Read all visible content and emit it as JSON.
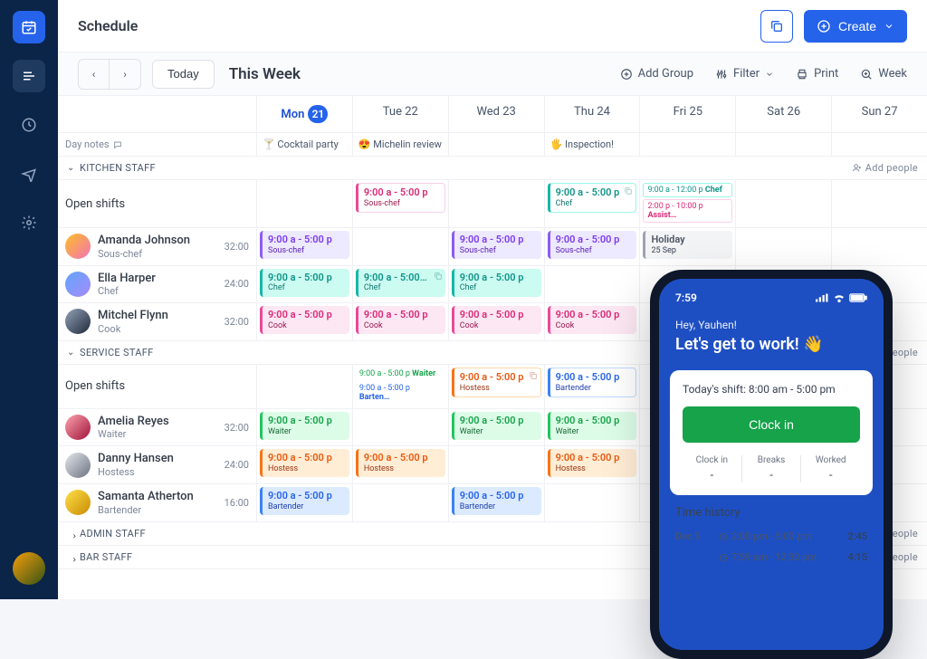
{
  "page": {
    "title": "Schedule"
  },
  "topbar": {
    "create_label": "Create"
  },
  "toolbar": {
    "today": "Today",
    "this_week": "This Week",
    "add_group": "Add Group",
    "filter": "Filter",
    "print": "Print",
    "week": "Week"
  },
  "days": [
    {
      "label": "Mon",
      "num": "21",
      "today": true
    },
    {
      "label": "Tue 22"
    },
    {
      "label": "Wed 23"
    },
    {
      "label": "Thu 24"
    },
    {
      "label": "Fri 25"
    },
    {
      "label": "Sat 26"
    },
    {
      "label": "Sun 27"
    }
  ],
  "notes": {
    "label": "Day notes",
    "cells": [
      "🍸 Cocktail party",
      "😍 Michelin review",
      "",
      "🖐 Inspection!",
      "",
      "",
      ""
    ]
  },
  "groups": {
    "kitchen": {
      "label": "KITCHEN STAFF"
    },
    "service": {
      "label": "SERVICE STAFF"
    },
    "admin": {
      "label": "ADMIN STAFF"
    },
    "bar": {
      "label": "BAR STAFF"
    },
    "add_people": "Add people",
    "open_shifts": "Open shifts"
  },
  "kitchen_open": {
    "tue": {
      "time": "9:00 a - 5:00 p",
      "role": "Sous-chef"
    },
    "thu": {
      "time": "9:00 a - 5:00 p",
      "role": "Chef"
    },
    "fri_a": {
      "time": "9:00 a - 12:00 p",
      "role": "Chef"
    },
    "fri_b": {
      "time": "2:00 p - 10:00 p",
      "role": "Assist…"
    }
  },
  "people": {
    "amanda": {
      "name": "Amanda Johnson",
      "role": "Sous-chef",
      "hours": "32:00"
    },
    "ella": {
      "name": "Ella Harper",
      "role": "Chef",
      "hours": "24:00"
    },
    "mitchel": {
      "name": "Mitchel Flynn",
      "role": "Cook",
      "hours": "32:00"
    },
    "amelia": {
      "name": "Amelia Reyes",
      "role": "Waiter",
      "hours": "32:00"
    },
    "danny": {
      "name": "Danny Hansen",
      "role": "Hostess",
      "hours": "24:00"
    },
    "samanta": {
      "name": "Samanta Atherton",
      "role": "Bartender",
      "hours": "16:00"
    }
  },
  "shifts": {
    "amanda": {
      "mon": {
        "time": "9:00 a - 5:00 p",
        "role": "Sous-chef"
      },
      "wed": {
        "time": "9:00 a - 5:00 p",
        "role": "Sous-chef"
      },
      "thu": {
        "time": "9:00 a - 5:00 p",
        "role": "Sous-chef"
      },
      "fri": {
        "time": "Holiday",
        "role": "25 Sep"
      }
    },
    "ella": {
      "mon": {
        "time": "9:00 a - 5:00 p",
        "role": "Chef"
      },
      "tue": {
        "time": "9:00 a - 5:00…",
        "role": "Chef"
      },
      "wed": {
        "time": "9:00 a - 5:00 p",
        "role": "Chef"
      }
    },
    "mitchel": {
      "mon": {
        "time": "9:00 a - 5:00 p",
        "role": "Cook"
      },
      "tue": {
        "time": "9:00 a - 5:00 p",
        "role": "Cook"
      },
      "wed": {
        "time": "9:00 a - 5:00 p",
        "role": "Cook"
      },
      "thu": {
        "time": "9:00 a - 5:00 p",
        "role": "Cook"
      }
    },
    "amelia": {
      "mon": {
        "time": "9:00 a - 5:00 p",
        "role": "Waiter"
      },
      "wed": {
        "time": "9:00 a - 5:00 p",
        "role": "Waiter"
      },
      "thu": {
        "time": "9:00 a - 5:00 p",
        "role": "Waiter"
      }
    },
    "danny": {
      "mon": {
        "time": "9:00 a - 5:00 p",
        "role": "Hostess"
      },
      "tue": {
        "time": "9:00 a - 5:00 p",
        "role": "Hostess"
      },
      "thu": {
        "time": "9:00 a - 5:00 p",
        "role": "Hostess"
      }
    },
    "samanta": {
      "mon": {
        "time": "9:00 a - 5:00 p",
        "role": "Bartender"
      },
      "wed": {
        "time": "9:00 a - 5:00 p",
        "role": "Bartender"
      }
    }
  },
  "service_open": {
    "tue_a": {
      "time": "9:00 a - 5:00 p",
      "role": "Waiter"
    },
    "tue_b": {
      "time": "9:00 a - 5:00 p",
      "role": "Barten…"
    },
    "wed": {
      "time": "9:00 a - 5:00 p",
      "role": "Hostess"
    },
    "thu": {
      "time": "9:00 a - 5:00 p",
      "role": "Bartender"
    }
  },
  "phone": {
    "time": "7:59",
    "hey": "Hey, Yauhen!",
    "hero": "Let's get to work! 👋",
    "today": "Today's shift: 8:00 am - 5:00 pm",
    "clock_in": "Clock in",
    "stats": [
      {
        "label": "Clock in",
        "val": "-"
      },
      {
        "label": "Breaks",
        "val": "-"
      },
      {
        "label": "Worked",
        "val": "-"
      }
    ],
    "history_title": "Time history",
    "history": [
      {
        "date": "Dec 9",
        "time": "2:00 pm - 5:00 pm",
        "dur": "2:45"
      },
      {
        "date": "",
        "time": "7:59 am - 12:30 pm",
        "dur": "4:15"
      }
    ]
  }
}
